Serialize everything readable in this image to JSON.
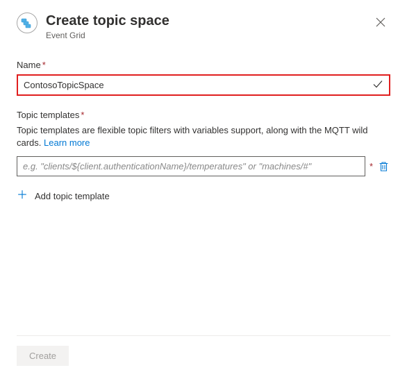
{
  "header": {
    "title": "Create topic space",
    "subtitle": "Event Grid"
  },
  "name_field": {
    "label": "Name",
    "value": "ContosoTopicSpace"
  },
  "templates_field": {
    "label": "Topic templates",
    "description_prefix": "Topic templates are flexible topic filters with variables support, along with the MQTT wild cards. ",
    "learn_more": "Learn more",
    "input_placeholder": "e.g. \"clients/${client.authenticationName}/temperatures\" or \"machines/#\"",
    "input_value": "",
    "add_label": "Add topic template"
  },
  "footer": {
    "create_label": "Create"
  }
}
